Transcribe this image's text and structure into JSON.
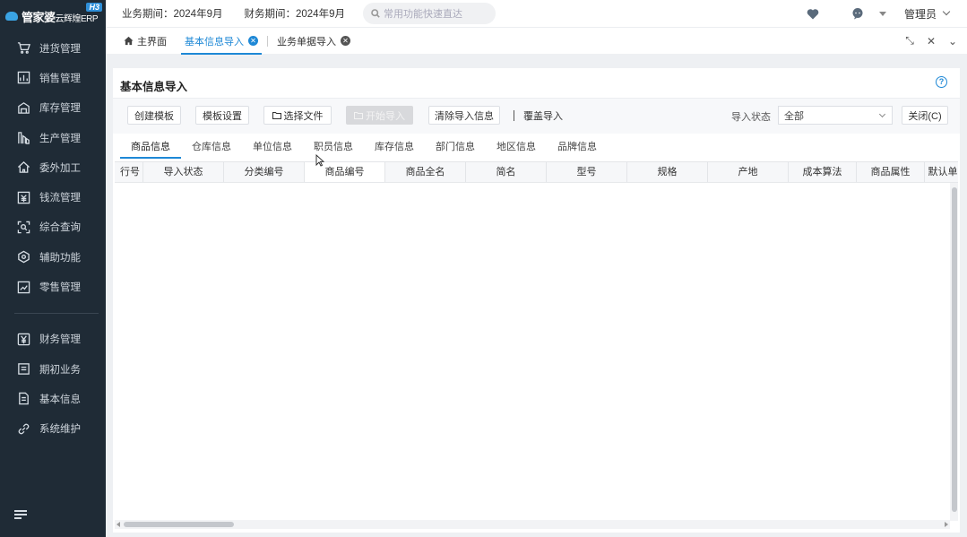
{
  "sidebar": {
    "logo_main": "管家婆",
    "logo_sub": "云辉煌ERP",
    "logo_badge": "H3",
    "items": [
      {
        "label": "进货管理",
        "icon": "cart-icon"
      },
      {
        "label": "销售管理",
        "icon": "sales-chart-icon"
      },
      {
        "label": "库存管理",
        "icon": "warehouse-icon"
      },
      {
        "label": "生产管理",
        "icon": "factory-icon"
      },
      {
        "label": "委外加工",
        "icon": "home-icon"
      },
      {
        "label": "钱流管理",
        "icon": "money-flow-icon"
      },
      {
        "label": "综合查询",
        "icon": "query-icon"
      },
      {
        "label": "辅助功能",
        "icon": "hexagon-icon"
      },
      {
        "label": "零售管理",
        "icon": "retail-chart-icon"
      }
    ],
    "items2": [
      {
        "label": "财务管理",
        "icon": "yuan-icon"
      },
      {
        "label": "期初业务",
        "icon": "document-icon"
      },
      {
        "label": "基本信息",
        "icon": "info-doc-icon"
      },
      {
        "label": "系统维护",
        "icon": "link-icon"
      }
    ]
  },
  "topbar": {
    "period": "业务期间：2024年9月",
    "finance_period": "财务期间：2024年9月",
    "search_placeholder": "常用功能快速直达",
    "user": "管理员"
  },
  "tabs": [
    {
      "label": "主界面"
    },
    {
      "label": "基本信息导入"
    },
    {
      "label": "业务单据导入"
    }
  ],
  "panel": {
    "title": "基本信息导入",
    "buttons": {
      "create_template": "创建模板",
      "template_setup": "模板设置",
      "choose_file": "选择文件",
      "start_import": "开始导入",
      "clear_info": "清除导入信息",
      "close": "关闭(C)"
    },
    "overwrite_label": "覆盖导入",
    "status_label": "导入状态",
    "status_value": "全部",
    "subtabs": [
      "商品信息",
      "仓库信息",
      "单位信息",
      "职员信息",
      "库存信息",
      "部门信息",
      "地区信息",
      "品牌信息"
    ],
    "columns": [
      "行号",
      "导入状态",
      "分类编号",
      "商品编号",
      "商品全名",
      "简名",
      "型号",
      "规格",
      "产地",
      "成本算法",
      "商品属性",
      "默认单"
    ]
  }
}
